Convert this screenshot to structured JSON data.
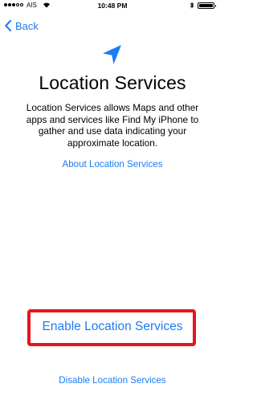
{
  "status_bar": {
    "carrier": "AIS",
    "time": "10:48 PM"
  },
  "nav": {
    "back_label": "Back"
  },
  "content": {
    "title": "Location Services",
    "description": "Location Services allows Maps and other apps and services like Find My iPhone to gather and use data indicating your approximate location.",
    "about_link": "About Location Services"
  },
  "actions": {
    "enable_label": "Enable Location Services",
    "disable_label": "Disable Location Services"
  },
  "colors": {
    "accent": "#1a7cf5",
    "highlight": "#e8141c"
  }
}
